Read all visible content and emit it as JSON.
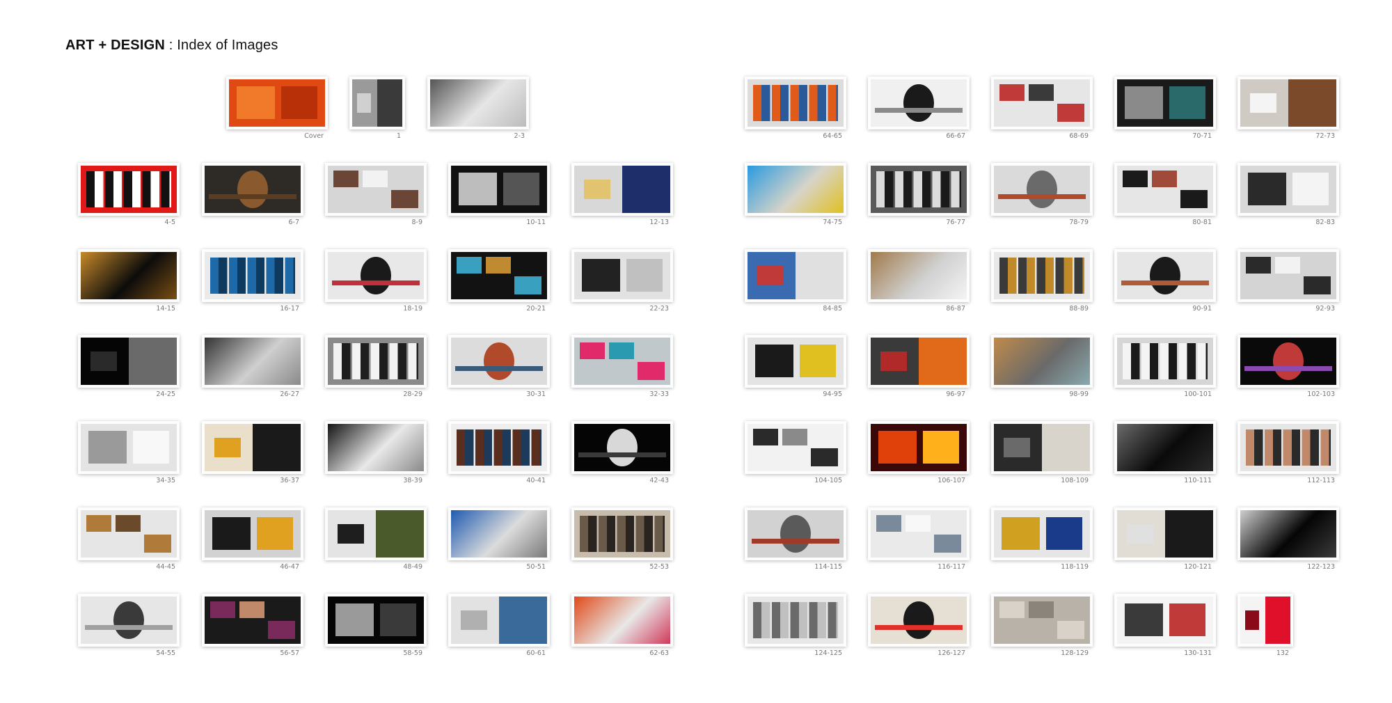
{
  "title": {
    "bold": "ART + DESIGN",
    "separator": " : ",
    "rest": "Index of Images"
  },
  "thumbnails": [
    {
      "label": "Cover",
      "bg": "#e04a12",
      "accent": "#f07a2a",
      "accent2": "#b83008"
    },
    {
      "label": "1",
      "bg": "#9a9a9a",
      "accent": "#3a3a3a",
      "accent2": "#d0d0d0"
    },
    {
      "label": "2-3",
      "bg": "#e6e6e6",
      "accent": "#555555",
      "accent2": "#bcbcbc"
    },
    {
      "label": "4-5",
      "bg": "#e01818",
      "accent": "#111111",
      "accent2": "#ffffff"
    },
    {
      "label": "6-7",
      "bg": "#2e2a26",
      "accent": "#8a5a2e",
      "accent2": "#5a3d22"
    },
    {
      "label": "8-9",
      "bg": "#d6d6d6",
      "accent": "#6b4636",
      "accent2": "#f2f2f2"
    },
    {
      "label": "10-11",
      "bg": "#111111",
      "accent": "#bdbdbd",
      "accent2": "#555555"
    },
    {
      "label": "12-13",
      "bg": "#d8d8d8",
      "accent": "#1e2e6a",
      "accent2": "#e2c470"
    },
    {
      "label": "14-15",
      "bg": "#0c0c0c",
      "accent": "#c88a2a",
      "accent2": "#7a4e14"
    },
    {
      "label": "16-17",
      "bg": "#eaeaea",
      "accent": "#1e6aa8",
      "accent2": "#0f3a60"
    },
    {
      "label": "18-19",
      "bg": "#e8e8e8",
      "accent": "#1a1a1a",
      "accent2": "#c0303a"
    },
    {
      "label": "20-21",
      "bg": "#121212",
      "accent": "#3aa0c0",
      "accent2": "#c08a30"
    },
    {
      "label": "22-23",
      "bg": "#e2e2e2",
      "accent": "#222222",
      "accent2": "#c0c0c0"
    },
    {
      "label": "24-25",
      "bg": "#050505",
      "accent": "#6a6a6a",
      "accent2": "#2a2a2a"
    },
    {
      "label": "26-27",
      "bg": "#cfcfcf",
      "accent": "#333333",
      "accent2": "#8a8a8a"
    },
    {
      "label": "28-29",
      "bg": "#8a8a8a",
      "accent": "#f2f2f2",
      "accent2": "#1e1e1e"
    },
    {
      "label": "30-31",
      "bg": "#dcdcdc",
      "accent": "#b04a2a",
      "accent2": "#3a5a7a"
    },
    {
      "label": "32-33",
      "bg": "#c0c8cc",
      "accent": "#e02a6a",
      "accent2": "#2a9ab0"
    },
    {
      "label": "34-35",
      "bg": "#e4e4e4",
      "accent": "#9a9a9a",
      "accent2": "#f8f8f8"
    },
    {
      "label": "36-37",
      "bg": "#eadfca",
      "accent": "#1a1a1a",
      "accent2": "#e0a020"
    },
    {
      "label": "38-39",
      "bg": "#e8e8e8",
      "accent": "#141414",
      "accent2": "#8a8a8a"
    },
    {
      "label": "40-41",
      "bg": "#eeeeee",
      "accent": "#5a2e1e",
      "accent2": "#1e3a5a"
    },
    {
      "label": "42-43",
      "bg": "#050505",
      "accent": "#d8d8d8",
      "accent2": "#3a3a3a"
    },
    {
      "label": "44-45",
      "bg": "#e6e6e6",
      "accent": "#b07a3a",
      "accent2": "#6a4a2a"
    },
    {
      "label": "46-47",
      "bg": "#d2d2d2",
      "accent": "#1a1a1a",
      "accent2": "#e0a020"
    },
    {
      "label": "48-49",
      "bg": "#e4e4e4",
      "accent": "#4a5a2a",
      "accent2": "#1e1e1e"
    },
    {
      "label": "50-51",
      "bg": "#dcdcdc",
      "accent": "#1e5ab0",
      "accent2": "#7a7a7a"
    },
    {
      "label": "52-53",
      "bg": "#c8bcac",
      "accent": "#6a5a4a",
      "accent2": "#2a2420"
    },
    {
      "label": "54-55",
      "bg": "#e6e6e6",
      "accent": "#3a3a3a",
      "accent2": "#a0a0a0"
    },
    {
      "label": "56-57",
      "bg": "#1a1a1a",
      "accent": "#7a2a5a",
      "accent2": "#c08a6a"
    },
    {
      "label": "58-59",
      "bg": "#050505",
      "accent": "#9a9a9a",
      "accent2": "#3a3a3a"
    },
    {
      "label": "60-61",
      "bg": "#e2e2e2",
      "accent": "#3a6a9a",
      "accent2": "#b0b0b0"
    },
    {
      "label": "62-63",
      "bg": "#e8e8e8",
      "accent": "#e04a1a",
      "accent2": "#d03a5a"
    },
    {
      "label": "64-65",
      "bg": "#dcdcdc",
      "accent": "#e05a1a",
      "accent2": "#2a5a9a"
    },
    {
      "label": "66-67",
      "bg": "#f0f0f0",
      "accent": "#1a1a1a",
      "accent2": "#8a8a8a"
    },
    {
      "label": "68-69",
      "bg": "#e6e6e6",
      "accent": "#c03a3a",
      "accent2": "#3a3a3a"
    },
    {
      "label": "70-71",
      "bg": "#1a1a1a",
      "accent": "#8a8a8a",
      "accent2": "#2a6a6a"
    },
    {
      "label": "72-73",
      "bg": "#cfcac4",
      "accent": "#7a4a2a",
      "accent2": "#f4f4f4"
    },
    {
      "label": "74-75",
      "bg": "#d8d4c8",
      "accent": "#2a9ae0",
      "accent2": "#e0c020"
    },
    {
      "label": "76-77",
      "bg": "#5a5a5a",
      "accent": "#dcdcdc",
      "accent2": "#1a1a1a"
    },
    {
      "label": "78-79",
      "bg": "#dadada",
      "accent": "#6a6a6a",
      "accent2": "#b04a2a"
    },
    {
      "label": "80-81",
      "bg": "#e6e6e6",
      "accent": "#1a1a1a",
      "accent2": "#a04a3a"
    },
    {
      "label": "82-83",
      "bg": "#d8d8d8",
      "accent": "#2a2a2a",
      "accent2": "#f4f4f4"
    },
    {
      "label": "84-85",
      "bg": "#3a6ab0",
      "accent": "#e0e0e0",
      "accent2": "#c03a3a"
    },
    {
      "label": "86-87",
      "bg": "#d0d0d0",
      "accent": "#a07a4a",
      "accent2": "#f4f4f4"
    },
    {
      "label": "88-89",
      "bg": "#e8e8e8",
      "accent": "#3a3a3a",
      "accent2": "#c08a2a"
    },
    {
      "label": "90-91",
      "bg": "#e6e6e6",
      "accent": "#1a1a1a",
      "accent2": "#b05a3a"
    },
    {
      "label": "92-93",
      "bg": "#d4d4d4",
      "accent": "#2a2a2a",
      "accent2": "#f2f2f2"
    },
    {
      "label": "94-95",
      "bg": "#e4e4e4",
      "accent": "#1a1a1a",
      "accent2": "#e0c020"
    },
    {
      "label": "96-97",
      "bg": "#3a3a3a",
      "accent": "#e06a1a",
      "accent2": "#b02a2a"
    },
    {
      "label": "98-99",
      "bg": "#6a6a6a",
      "accent": "#c08a4a",
      "accent2": "#8aaab0"
    },
    {
      "label": "100-101",
      "bg": "#d6d6d6",
      "accent": "#f4f4f4",
      "accent2": "#1a1a1a"
    },
    {
      "label": "102-103",
      "bg": "#0a0a0a",
      "accent": "#c03a3a",
      "accent2": "#8a4ab0"
    },
    {
      "label": "104-105",
      "bg": "#f2f2f2",
      "accent": "#2a2a2a",
      "accent2": "#8a8a8a"
    },
    {
      "label": "106-107",
      "bg": "#3a0808",
      "accent": "#e0400a",
      "accent2": "#ffb01a"
    },
    {
      "label": "108-109",
      "bg": "#2a2a2a",
      "accent": "#d8d4cc",
      "accent2": "#6a6a6a"
    },
    {
      "label": "110-111",
      "bg": "#0a0a0a",
      "accent": "#6a6a6a",
      "accent2": "#2a2a2a"
    },
    {
      "label": "112-113",
      "bg": "#e6e6e6",
      "accent": "#c08a6a",
      "accent2": "#2a2a2a"
    },
    {
      "label": "114-115",
      "bg": "#d2d2d2",
      "accent": "#5a5a5a",
      "accent2": "#a03a2a"
    },
    {
      "label": "116-117",
      "bg": "#eaeaea",
      "accent": "#7a8a9a",
      "accent2": "#f8f8f8"
    },
    {
      "label": "118-119",
      "bg": "#e6e6e6",
      "accent": "#d0a020",
      "accent2": "#1a3a8a"
    },
    {
      "label": "120-121",
      "bg": "#e2ddd4",
      "accent": "#1a1a1a",
      "accent2": "#e0e0e0"
    },
    {
      "label": "122-123",
      "bg": "#050505",
      "accent": "#cfcfcf",
      "accent2": "#3a3a3a"
    },
    {
      "label": "124-125",
      "bg": "#e8e8e8",
      "accent": "#6a6a6a",
      "accent2": "#c0c0c0"
    },
    {
      "label": "126-127",
      "bg": "#e6e0d4",
      "accent": "#1a1a1a",
      "accent2": "#e0302a"
    },
    {
      "label": "128-129",
      "bg": "#b8b2a8",
      "accent": "#d8d2c8",
      "accent2": "#8a847a"
    },
    {
      "label": "130-131",
      "bg": "#f4f4f4",
      "accent": "#3a3a3a",
      "accent2": "#c03a3a"
    },
    {
      "label": "132",
      "bg": "#f4f4f4",
      "accent": "#e0102a",
      "accent2": "#8a0a1a"
    }
  ]
}
